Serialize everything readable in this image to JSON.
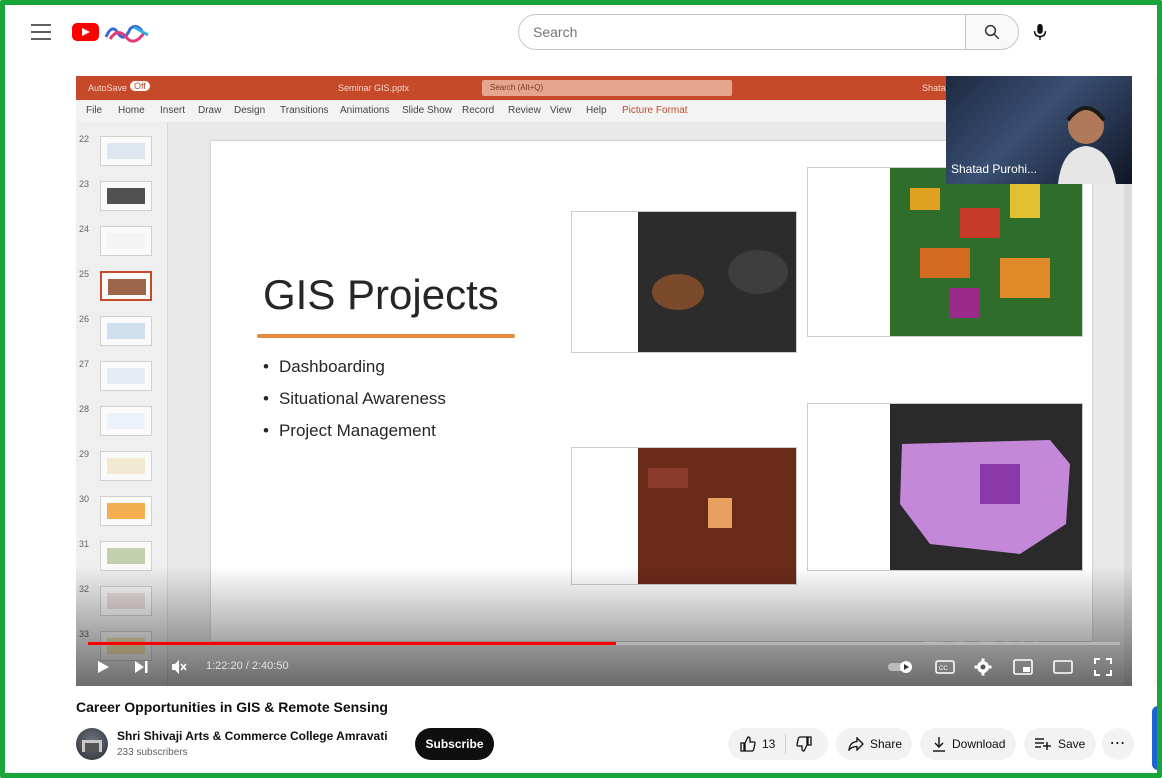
{
  "masthead": {
    "search_placeholder": "Search",
    "icons": [
      "menu-icon",
      "youtube-logo-icon",
      "search-icon",
      "microphone-icon"
    ]
  },
  "powerpoint": {
    "autosave_label": "AutoSave",
    "autosave_state": "Off",
    "file_name": "Seminar GIS.pptx",
    "search_placeholder": "Search (Alt+Q)",
    "user_short": "Shatad",
    "menu": [
      "File",
      "Home",
      "Insert",
      "Draw",
      "Design",
      "Transitions",
      "Animations",
      "Slide Show",
      "Record",
      "Review",
      "View",
      "Help",
      "Picture Format"
    ],
    "thumbnails": [
      {
        "num": "22",
        "active": false
      },
      {
        "num": "23",
        "active": false
      },
      {
        "num": "24",
        "active": false
      },
      {
        "num": "25",
        "active": true
      },
      {
        "num": "26",
        "active": false
      },
      {
        "num": "27",
        "active": false
      },
      {
        "num": "28",
        "active": false
      },
      {
        "num": "29",
        "active": false
      },
      {
        "num": "30",
        "active": false
      },
      {
        "num": "31",
        "active": false
      },
      {
        "num": "32",
        "active": false
      },
      {
        "num": "33",
        "active": false
      }
    ],
    "slide": {
      "title": "GIS Projects",
      "bullets": [
        "Dashboarding",
        "Situational Awareness",
        "Project Management"
      ]
    }
  },
  "webcam": {
    "name": "Shatad Purohi..."
  },
  "watermark": "zoom",
  "player": {
    "current_time": "1:22:20",
    "duration": "2:40:50",
    "time_display": "1:22:20 / 2:40:50",
    "progress": 0.512,
    "icons": [
      "play-icon",
      "next-icon",
      "mute-icon",
      "autoplay-toggle-icon",
      "captions-icon",
      "settings-icon",
      "miniplayer-icon",
      "theater-icon",
      "fullscreen-icon"
    ]
  },
  "video": {
    "title": "Career Opportunities in GIS & Remote Sensing",
    "channel_name": "Shri Shivaji Arts & Commerce College Amravati",
    "subscribers": "233 subscribers",
    "subscribe_label": "Subscribe",
    "like_count": "13",
    "share_label": "Share",
    "download_label": "Download",
    "save_label": "Save"
  },
  "colors": {
    "youtube_red": "#ff0000",
    "ppt_orange": "#c44a2a",
    "frame_green": "#1aa53a",
    "accent_underline": "#e88a3c"
  }
}
